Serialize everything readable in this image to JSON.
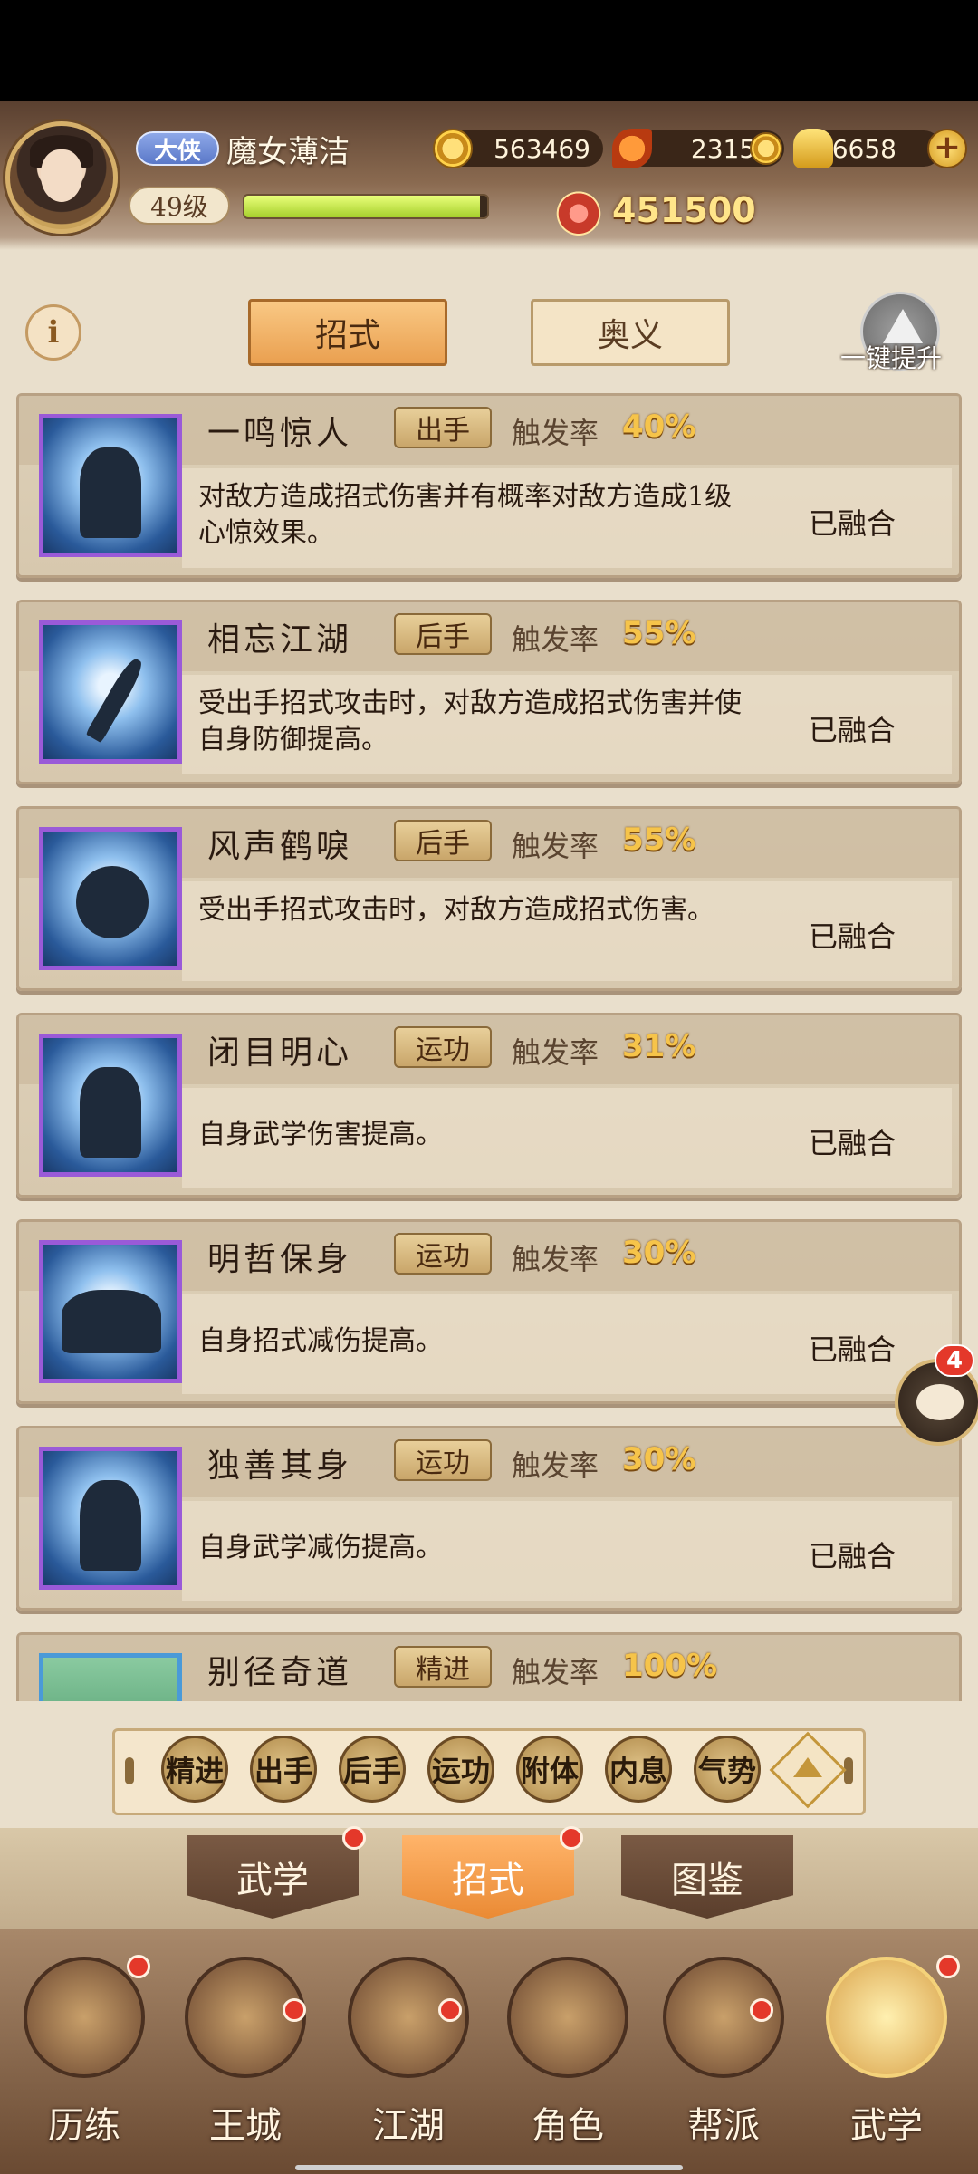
{
  "player": {
    "title": "大侠",
    "name": "魔女薄洁",
    "level": "49级",
    "exp_fraction": 0.97,
    "power": "451500"
  },
  "currencies": {
    "coins": "563469",
    "leaves": "23153",
    "ingots": "16658"
  },
  "tabs": {
    "active": "招式",
    "inactive": "奥义",
    "upgrade_all": "一键提升"
  },
  "trigger_label": "触发率",
  "skills": [
    {
      "name": "一鸣惊人",
      "type": "出手",
      "rate": "40%",
      "desc": "对敌方造成招式伤害并有概率对敌方造成1级心惊效果。",
      "status": "已融合"
    },
    {
      "name": "相忘江湖",
      "type": "后手",
      "rate": "55%",
      "desc": "受出手招式攻击时，对敌方造成招式伤害并使自身防御提高。",
      "status": "已融合"
    },
    {
      "name": "风声鹤唳",
      "type": "后手",
      "rate": "55%",
      "desc": "受出手招式攻击时，对敌方造成招式伤害。",
      "status": "已融合"
    },
    {
      "name": "闭目明心",
      "type": "运功",
      "rate": "31%",
      "desc": "自身武学伤害提高。",
      "status": "已融合"
    },
    {
      "name": "明哲保身",
      "type": "运功",
      "rate": "30%",
      "desc": "自身招式减伤提高。",
      "status": "已融合"
    },
    {
      "name": "独善其身",
      "type": "运功",
      "rate": "30%",
      "desc": "自身武学减伤提高。",
      "status": "已融合"
    },
    {
      "name": "别径奇道",
      "type": "精进",
      "rate": "100%",
      "desc": "",
      "status": ""
    }
  ],
  "filters": [
    "精进",
    "出手",
    "后手",
    "运功",
    "附体",
    "内息",
    "气势"
  ],
  "subtabs": [
    "武学",
    "招式",
    "图鉴"
  ],
  "nav": [
    "历练",
    "王城",
    "江湖",
    "角色",
    "帮派",
    "武学"
  ],
  "chat_badge": "4",
  "colors": {
    "accent": "#eaa050",
    "rate": "#f6c44a",
    "badge": "#e4382a"
  }
}
